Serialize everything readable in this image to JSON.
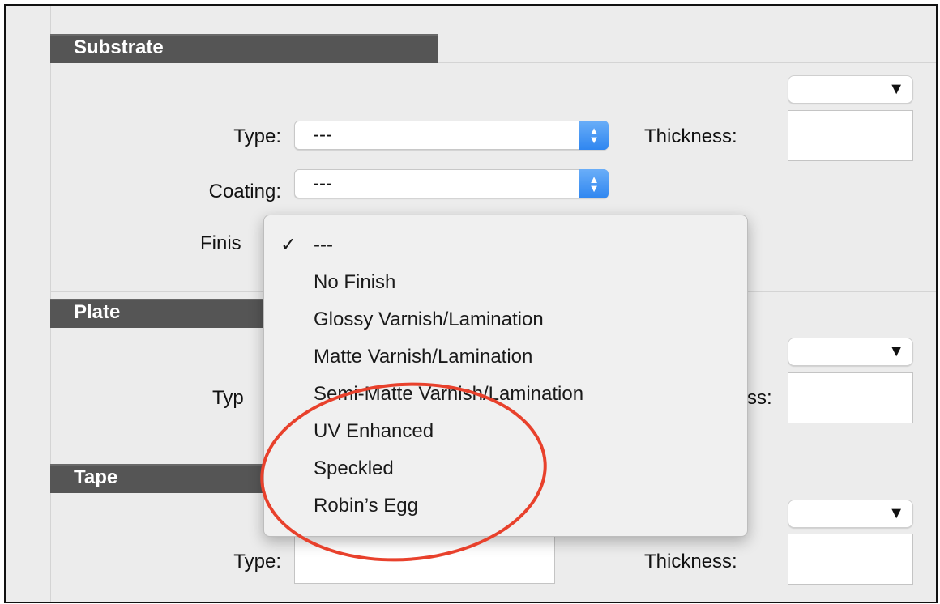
{
  "sections": {
    "substrate": {
      "title": "Substrate",
      "type_label": "Type:",
      "type_value": "---",
      "thickness_label": "Thickness:",
      "coating_label": "Coating:",
      "coating_value": "---",
      "finish_label": "Finis"
    },
    "plate": {
      "title": "Plate",
      "type_label": "Typ",
      "thickness_label_partial": "ss:"
    },
    "tape": {
      "title": "Tape",
      "type_label": "Type:",
      "thickness_label": "Thickness:"
    }
  },
  "finish_menu": {
    "selected_index": 0,
    "check_glyph": "✓",
    "items": [
      "---",
      "No Finish",
      "Glossy Varnish/Lamination",
      "Matte Varnish/Lamination",
      "Semi-Matte Varnish/Lamination",
      "UV Enhanced",
      "Speckled",
      "Robin’s Egg"
    ]
  },
  "icons": {
    "dropdown_arrow": "▼",
    "stepper_up": "▲",
    "stepper_down": "▼"
  },
  "colors": {
    "section_header": "#555555",
    "stepper_accent": "#2f86f0",
    "annotation": "#e8412c"
  }
}
